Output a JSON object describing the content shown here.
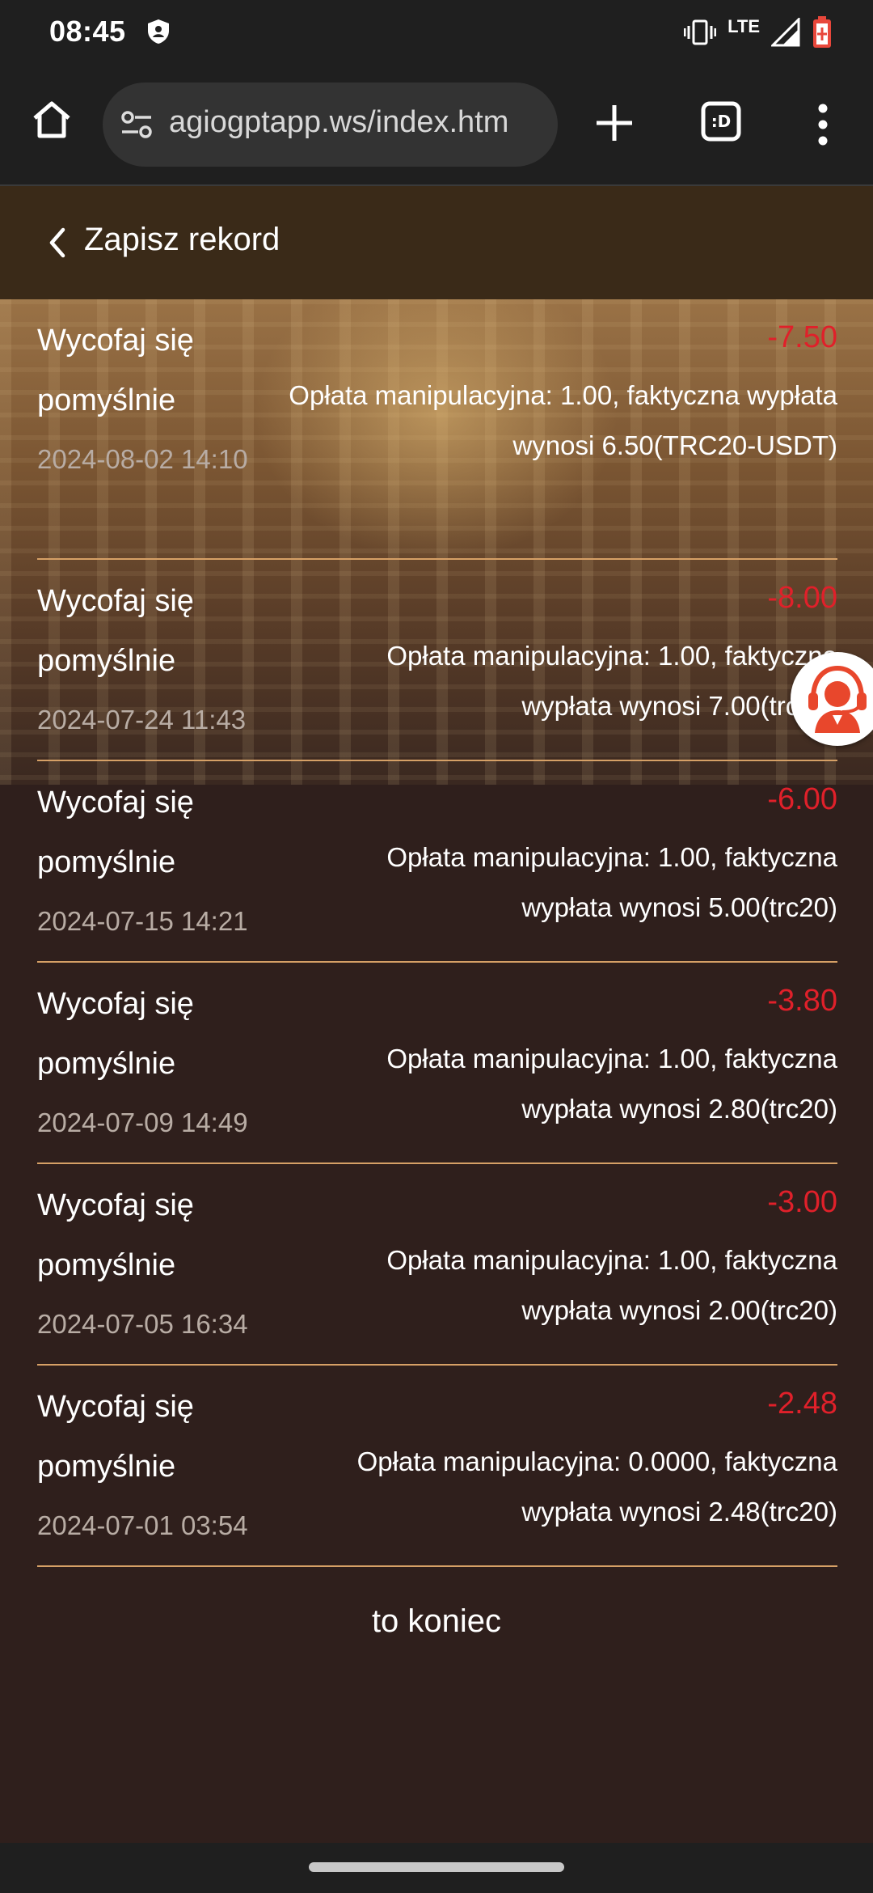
{
  "status_bar": {
    "time": "08:45",
    "network": "LTE",
    "icons": [
      "shield-icon",
      "vibrate-icon",
      "signal-icon",
      "battery-icon"
    ]
  },
  "browser": {
    "url": "agiogptapp.ws/index.htm",
    "tab_icon_label": ":D"
  },
  "header": {
    "title": "Zapisz rekord"
  },
  "records": [
    {
      "status": "Wycofaj się pomyślnie",
      "date": "2024-08-02 14:10",
      "amount": "-7.50",
      "desc": "Opłata manipulacyjna: 1.00, faktyczna wypłata wynosi 6.50(TRC20-USDT)"
    },
    {
      "status": "Wycofaj się pomyślnie",
      "date": "2024-07-24 11:43",
      "amount": "-8.00",
      "desc": "Opłata manipulacyjna: 1.00, faktyczna wypłata wynosi 7.00(trc20)"
    },
    {
      "status": "Wycofaj się pomyślnie",
      "date": "2024-07-15 14:21",
      "amount": "-6.00",
      "desc": "Opłata manipulacyjna: 1.00, faktyczna wypłata wynosi 5.00(trc20)"
    },
    {
      "status": "Wycofaj się pomyślnie",
      "date": "2024-07-09 14:49",
      "amount": "-3.80",
      "desc": "Opłata manipulacyjna: 1.00, faktyczna wypłata wynosi 2.80(trc20)"
    },
    {
      "status": "Wycofaj się pomyślnie",
      "date": "2024-07-05 16:34",
      "amount": "-3.00",
      "desc": "Opłata manipulacyjna: 1.00, faktyczna wypłata wynosi 2.00(trc20)"
    },
    {
      "status": "Wycofaj się pomyślnie",
      "date": "2024-07-01 03:54",
      "amount": "-2.48",
      "desc": "Opłata manipulacyjna: 0.0000, faktyczna wypłata wynosi 2.48(trc20)"
    }
  ],
  "end_text": "to koniec",
  "colors": {
    "amount": "#e0202a",
    "divider": "#d6a066",
    "background": "#2f1f1c",
    "header": "#3a2a18"
  }
}
